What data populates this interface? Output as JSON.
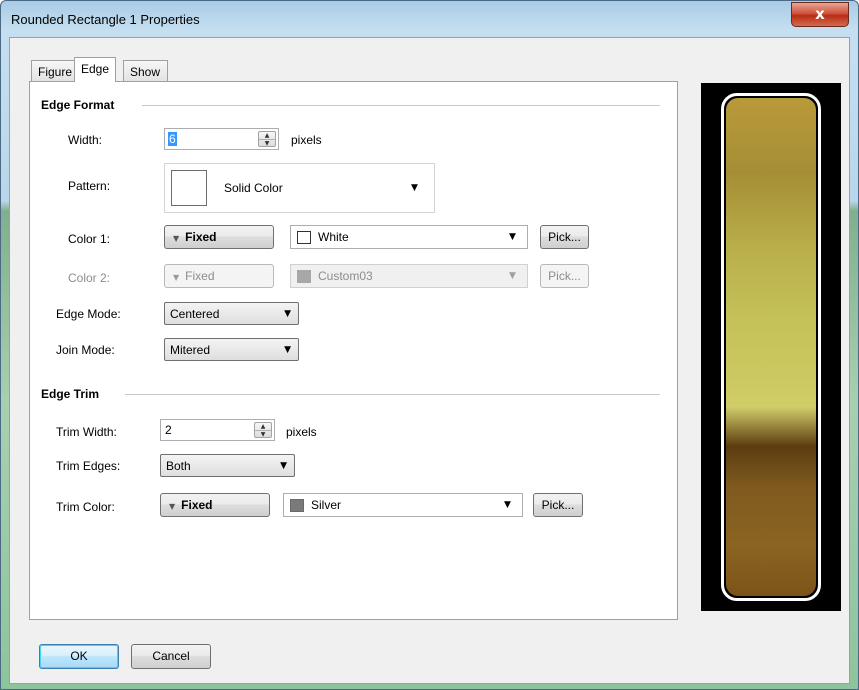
{
  "window": {
    "title": "Rounded Rectangle 1 Properties",
    "close_glyph": "x"
  },
  "tabs": [
    {
      "label": "Figure",
      "active": false
    },
    {
      "label": "Edge",
      "active": true
    },
    {
      "label": "Show",
      "active": false
    }
  ],
  "edge_format": {
    "section_title": "Edge Format",
    "width": {
      "label": "Width:",
      "value": "6",
      "unit": "pixels"
    },
    "pattern": {
      "label": "Pattern:",
      "value": "Solid Color"
    },
    "color1": {
      "label": "Color 1:",
      "mode": "Fixed",
      "color_name": "White",
      "swatch": "#ffffff",
      "pick": "Pick..."
    },
    "color2": {
      "label": "Color 2:",
      "mode": "Fixed",
      "color_name": "Custom03",
      "swatch": "#a8a8a8",
      "pick": "Pick...",
      "enabled": false
    },
    "edge_mode": {
      "label": "Edge Mode:",
      "value": "Centered"
    },
    "join_mode": {
      "label": "Join Mode:",
      "value": "Mitered"
    }
  },
  "edge_trim": {
    "section_title": "Edge Trim",
    "trim_width": {
      "label": "Trim Width:",
      "value": "2",
      "unit": "pixels"
    },
    "trim_edges": {
      "label": "Trim Edges:",
      "value": "Both"
    },
    "trim_color": {
      "label": "Trim Color:",
      "mode": "Fixed",
      "color_name": "Silver",
      "swatch": "#7a7a7a",
      "pick": "Pick..."
    }
  },
  "buttons": {
    "ok": "OK",
    "cancel": "Cancel"
  },
  "icons": {
    "close": "close-icon",
    "spin": "spin-updown-icon",
    "dropdown": "chevron-down-icon",
    "menu_triangle": "triangle-down-icon"
  }
}
